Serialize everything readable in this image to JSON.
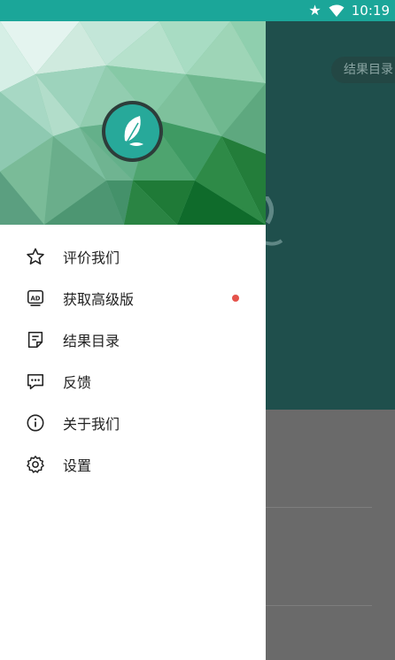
{
  "status_bar": {
    "time": "10:19",
    "icons": [
      "star-icon",
      "wifi-icon"
    ]
  },
  "background": {
    "chip_label": "结果目录"
  },
  "drawer": {
    "logo": "feather-leaf-icon",
    "menu": [
      {
        "label": "评价我们",
        "icon": "star-outline-icon"
      },
      {
        "label": "获取高级版",
        "icon": "ad-badge-icon",
        "badge": "red-dot"
      },
      {
        "label": "结果目录",
        "icon": "document-list-icon"
      },
      {
        "label": "反馈",
        "icon": "feedback-bubble-icon"
      },
      {
        "label": "关于我们",
        "icon": "info-icon"
      },
      {
        "label": "设置",
        "icon": "gear-icon"
      }
    ]
  },
  "colors": {
    "status_bar": "#1ba699",
    "accent": "#27a99a",
    "badge": "#e5534b"
  }
}
